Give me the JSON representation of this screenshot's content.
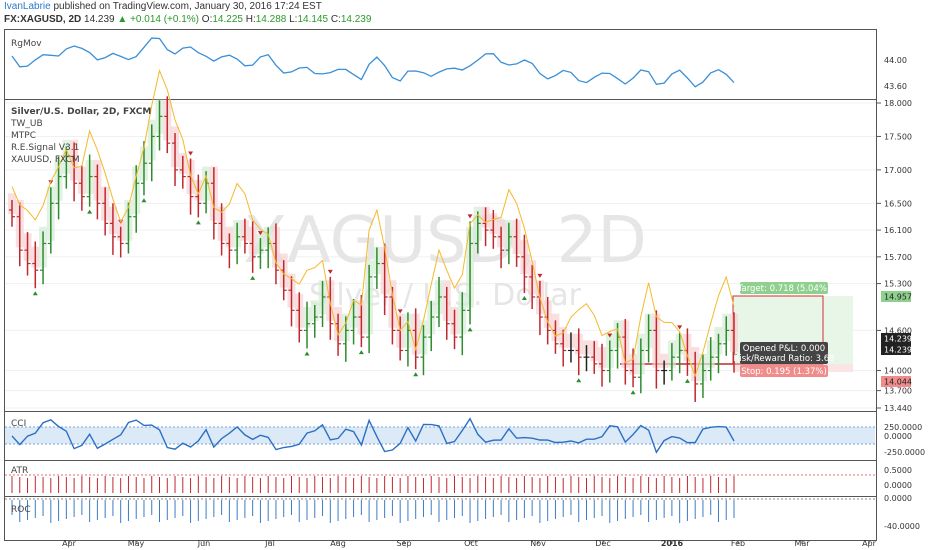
{
  "header": {
    "author": "IvanLabrie",
    "published": " published on TradingView.com, January 30, 2016 17:24 EST",
    "symbol": "FX:XAGUSD, 2D",
    "last": "14.239",
    "change_arrow": "▲",
    "change": "+0.014 (+0.1%)",
    "o_label": "O:",
    "o": "14.225",
    "h_label": "H:",
    "h": "14.288",
    "l_label": "L:",
    "l": "14.145",
    "c_label": "C:",
    "c": "14.239"
  },
  "watermark": {
    "symbol": "XAGUSD, 2D",
    "name": "Silver / U.S. Dollar"
  },
  "panes": {
    "rgmov": {
      "label": "RgMov",
      "ticks": [
        "44.00",
        "43.60"
      ]
    },
    "main": {
      "labels": [
        "Silver/U.S. Dollar, 2D, FXCM",
        "TW_UB",
        "MTPC",
        "R.E.Signal V3.1",
        "XAUUSD, FXCM"
      ],
      "ticks": [
        "18.000",
        "17.500",
        "17.000",
        "16.500",
        "16.100",
        "15.700",
        "15.300",
        "14.600",
        "14.000",
        "13.700",
        "13.440"
      ]
    },
    "cci": {
      "label": "CCI",
      "ticks": [
        "250.0000",
        "0.0000",
        "-250.0000"
      ]
    },
    "atr": {
      "label": "ATR",
      "ticks": [
        "0.5000",
        "0.0000"
      ]
    },
    "roc": {
      "label": "ROC",
      "ticks": [
        "0.0000",
        "-40.0000"
      ]
    }
  },
  "price_tags": {
    "target": "14.957",
    "last": "14.239",
    "last2": "14.239",
    "stop": "14.044"
  },
  "position": {
    "target_label": "Target: 0.718 (5.04%)",
    "pnl_label": "Opened P&L: 0.000",
    "rr_label": "Risk/Reward Ratio: 3.68",
    "stop_label": "Stop: 0.195 (1.37%)"
  },
  "x_axis": [
    "Apr",
    "May",
    "Jun",
    "Jul",
    "Aug",
    "Sep",
    "Oct",
    "Nov",
    "Dec",
    "2016",
    "Feb",
    "Mar",
    "Apr"
  ],
  "colors": {
    "up": "#2e8b2e",
    "down": "#c0282e",
    "neutral": "#222222",
    "line_blue": "#3a8fd8",
    "line_orange": "#f5b92a",
    "target_green": "#8fd08f",
    "stop_red": "#f08c8c"
  },
  "chart_data": {
    "type": "candlestick",
    "title": "Silver/U.S. Dollar, 2D, FXCM",
    "close_approx": [
      16.3,
      15.8,
      15.6,
      15.5,
      15.9,
      16.5,
      16.9,
      17.2,
      16.8,
      16.6,
      16.9,
      16.5,
      16.2,
      16.0,
      15.9,
      16.3,
      16.8,
      17.1,
      17.5,
      17.8,
      17.4,
      17.0,
      16.9,
      16.6,
      16.5,
      16.8,
      16.2,
      15.9,
      15.8,
      16.0,
      15.9,
      15.7,
      15.8,
      15.9,
      15.5,
      15.2,
      14.9,
      14.6,
      14.7,
      14.8,
      15.1,
      14.7,
      14.4,
      14.6,
      14.8,
      14.5,
      15.4,
      15.6,
      15.1,
      14.6,
      14.3,
      14.6,
      14.2,
      14.5,
      14.8,
      15.1,
      14.7,
      14.5,
      14.9,
      15.9,
      16.2,
      16.1,
      16.0,
      15.8,
      16.0,
      15.7,
      15.4,
      15.1,
      14.8,
      14.6,
      14.4,
      14.3,
      14.3,
      14.2,
      14.2,
      14.1,
      14.0,
      14.3,
      14.5,
      14.0,
      13.9,
      14.3,
      14.6,
      14.0,
      14.0,
      14.2,
      14.3,
      14.1,
      13.8,
      14.0,
      14.2,
      14.4,
      14.6,
      14.239
    ],
    "ylim": [
      13.44,
      18.0
    ],
    "position": {
      "target": 14.957,
      "entry": 14.239,
      "stop": 14.044
    }
  }
}
